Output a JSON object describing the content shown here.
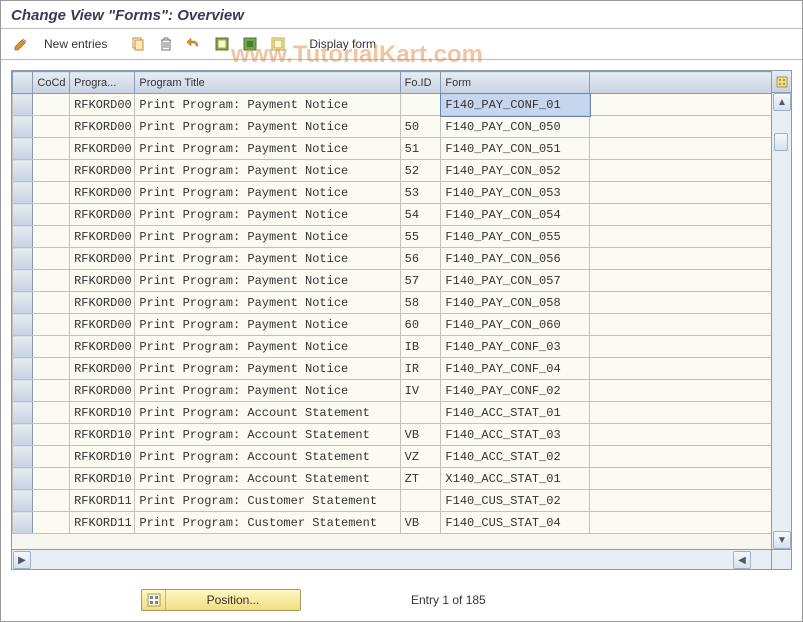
{
  "window": {
    "title": "Change View \"Forms\": Overview"
  },
  "toolbar": {
    "new_entries_label": "New entries",
    "display_form_label": "Display form"
  },
  "watermark": "www.TutorialKart.com",
  "table": {
    "headers": {
      "cocd": "CoCd",
      "program": "Progra...",
      "program_title": "Program Title",
      "foid": "Fo.ID",
      "form": "Form"
    },
    "rows": [
      {
        "cocd": "",
        "program": "RFKORD00",
        "title": "Print Program: Payment Notice",
        "foid": "",
        "form": "F140_PAY_CONF_01",
        "selected": true
      },
      {
        "cocd": "",
        "program": "RFKORD00",
        "title": "Print Program: Payment Notice",
        "foid": "50",
        "form": "F140_PAY_CON_050"
      },
      {
        "cocd": "",
        "program": "RFKORD00",
        "title": "Print Program: Payment Notice",
        "foid": "51",
        "form": "F140_PAY_CON_051"
      },
      {
        "cocd": "",
        "program": "RFKORD00",
        "title": "Print Program: Payment Notice",
        "foid": "52",
        "form": "F140_PAY_CON_052"
      },
      {
        "cocd": "",
        "program": "RFKORD00",
        "title": "Print Program: Payment Notice",
        "foid": "53",
        "form": "F140_PAY_CON_053"
      },
      {
        "cocd": "",
        "program": "RFKORD00",
        "title": "Print Program: Payment Notice",
        "foid": "54",
        "form": "F140_PAY_CON_054"
      },
      {
        "cocd": "",
        "program": "RFKORD00",
        "title": "Print Program: Payment Notice",
        "foid": "55",
        "form": "F140_PAY_CON_055"
      },
      {
        "cocd": "",
        "program": "RFKORD00",
        "title": "Print Program: Payment Notice",
        "foid": "56",
        "form": "F140_PAY_CON_056"
      },
      {
        "cocd": "",
        "program": "RFKORD00",
        "title": "Print Program: Payment Notice",
        "foid": "57",
        "form": "F140_PAY_CON_057"
      },
      {
        "cocd": "",
        "program": "RFKORD00",
        "title": "Print Program: Payment Notice",
        "foid": "58",
        "form": "F140_PAY_CON_058"
      },
      {
        "cocd": "",
        "program": "RFKORD00",
        "title": "Print Program: Payment Notice",
        "foid": "60",
        "form": "F140_PAY_CON_060"
      },
      {
        "cocd": "",
        "program": "RFKORD00",
        "title": "Print Program: Payment Notice",
        "foid": "IB",
        "form": "F140_PAY_CONF_03"
      },
      {
        "cocd": "",
        "program": "RFKORD00",
        "title": "Print Program: Payment Notice",
        "foid": "IR",
        "form": "F140_PAY_CONF_04"
      },
      {
        "cocd": "",
        "program": "RFKORD00",
        "title": "Print Program: Payment Notice",
        "foid": "IV",
        "form": "F140_PAY_CONF_02"
      },
      {
        "cocd": "",
        "program": "RFKORD10",
        "title": "Print Program: Account Statement",
        "foid": "",
        "form": "F140_ACC_STAT_01"
      },
      {
        "cocd": "",
        "program": "RFKORD10",
        "title": "Print Program: Account Statement",
        "foid": "VB",
        "form": "F140_ACC_STAT_03"
      },
      {
        "cocd": "",
        "program": "RFKORD10",
        "title": "Print Program: Account Statement",
        "foid": "VZ",
        "form": "F140_ACC_STAT_02"
      },
      {
        "cocd": "",
        "program": "RFKORD10",
        "title": "Print Program: Account Statement",
        "foid": "ZT",
        "form": "X140_ACC_STAT_01"
      },
      {
        "cocd": "",
        "program": "RFKORD11",
        "title": "Print Program: Customer Statement",
        "foid": "",
        "form": "F140_CUS_STAT_02"
      },
      {
        "cocd": "",
        "program": "RFKORD11",
        "title": "Print Program: Customer Statement",
        "foid": "VB",
        "form": "F140_CUS_STAT_04"
      }
    ]
  },
  "footer": {
    "position_label": "Position...",
    "entry_label": "Entry 1 of 185"
  }
}
